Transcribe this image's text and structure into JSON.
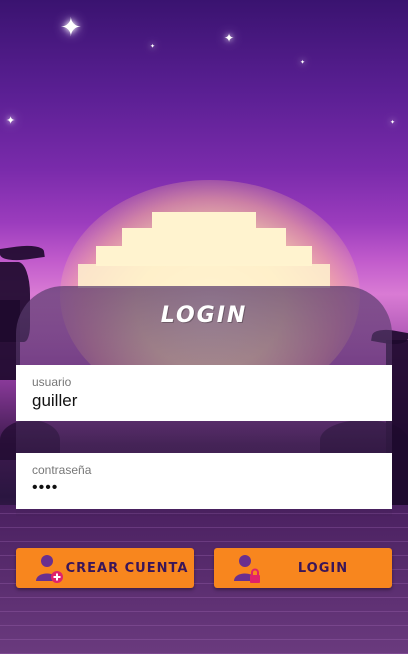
{
  "login": {
    "title": "LOGIN",
    "username_label": "usuario",
    "username_value": "guiller",
    "password_label": "contraseña",
    "password_value": "••••",
    "create_account_label": "CREAR CUENTA",
    "login_label": "LOGIN"
  },
  "icons": {
    "create_account_icon": "add-user-icon",
    "login_icon": "user-lock-icon"
  },
  "colors": {
    "accent": "#f8861e",
    "button_text": "#3a1558",
    "icon_purple": "#6a2f8e",
    "icon_badge": "#e0226a"
  }
}
